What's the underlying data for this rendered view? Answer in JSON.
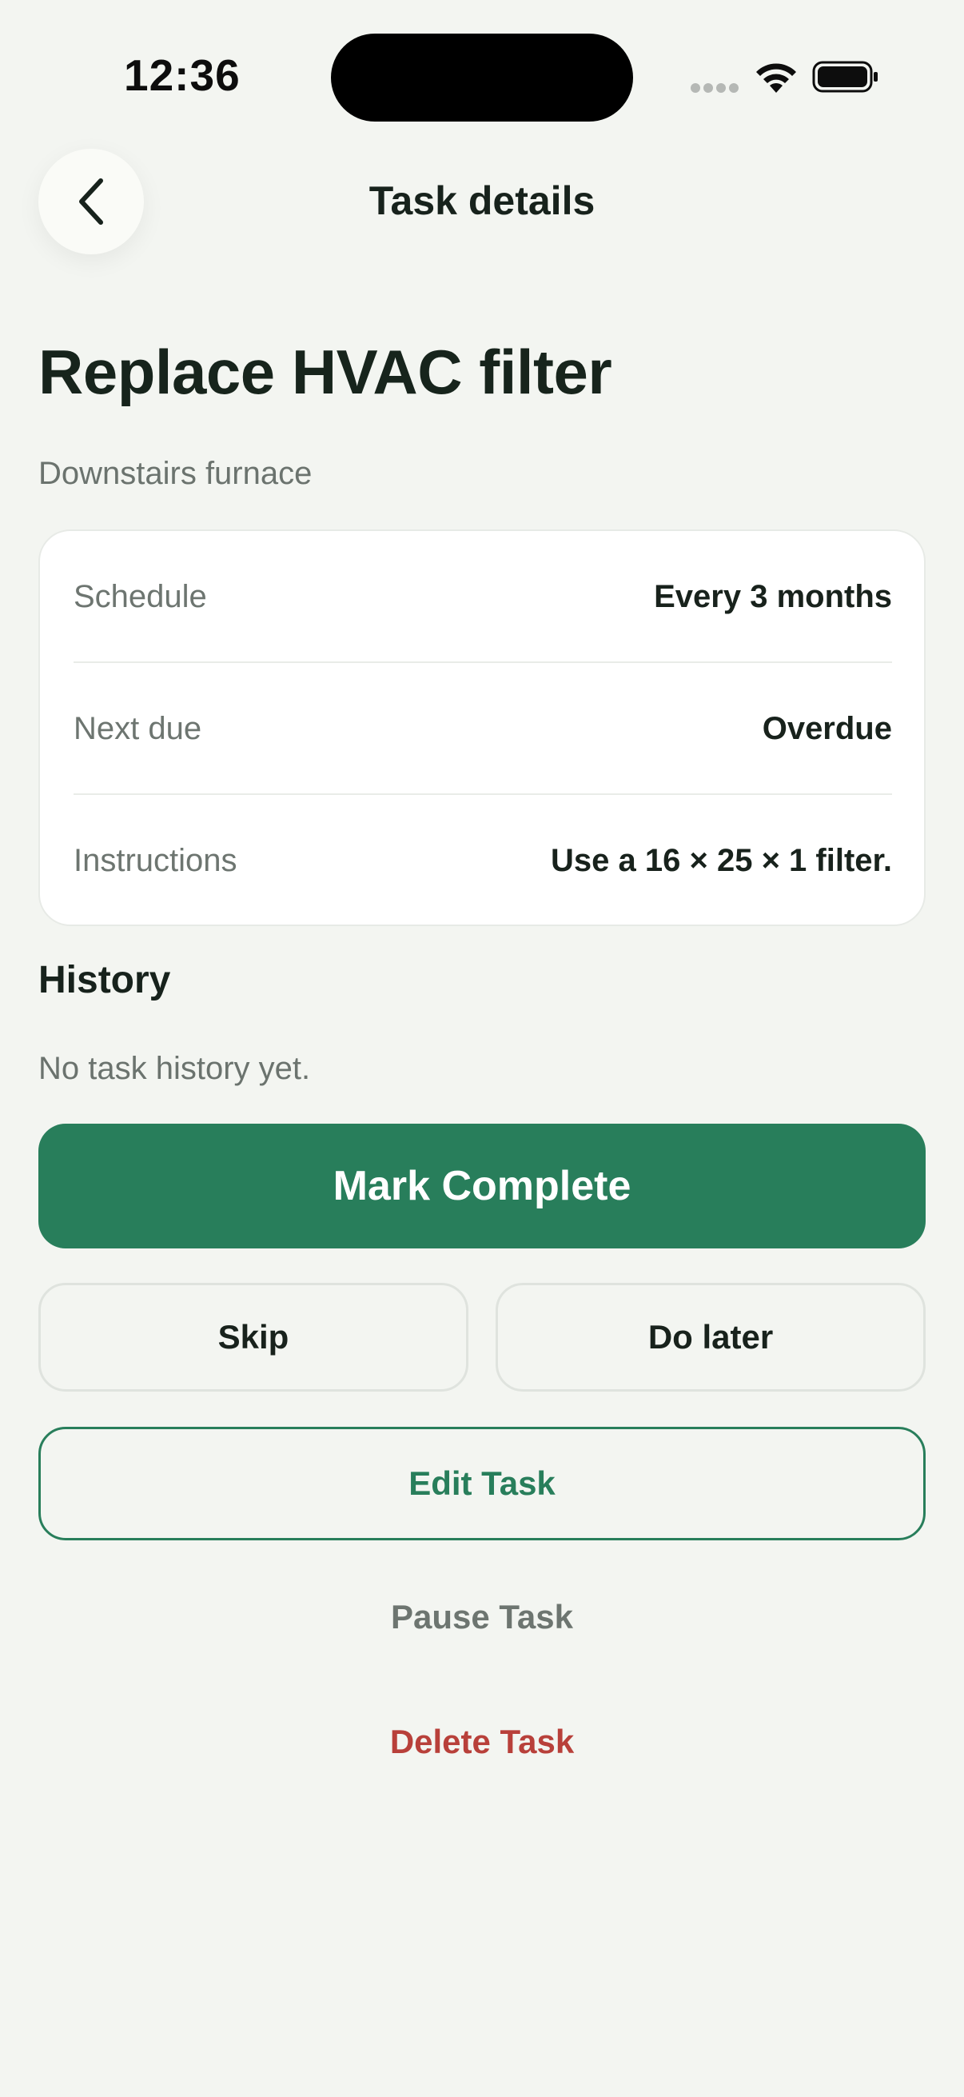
{
  "status_bar": {
    "time": "12:36"
  },
  "header": {
    "title": "Task details"
  },
  "task": {
    "title": "Replace HVAC filter",
    "subtitle": "Downstairs furnace"
  },
  "details": [
    {
      "label": "Schedule",
      "value": "Every 3 months"
    },
    {
      "label": "Next due",
      "value": "Overdue"
    },
    {
      "label": "Instructions",
      "value": "Use a 16 × 25 × 1 filter."
    }
  ],
  "history": {
    "heading": "History",
    "empty_text": "No task history yet."
  },
  "actions": {
    "mark_complete": "Mark Complete",
    "skip": "Skip",
    "do_later": "Do later",
    "edit": "Edit Task",
    "pause": "Pause Task",
    "delete": "Delete Task"
  },
  "colors": {
    "background": "#f3f5f1",
    "primary": "#287e5b",
    "danger": "#b8403a",
    "muted_text": "#6d7570"
  },
  "icons": [
    "back-chevron-icon",
    "cellular-signal-icon",
    "wifi-icon",
    "battery-icon"
  ]
}
